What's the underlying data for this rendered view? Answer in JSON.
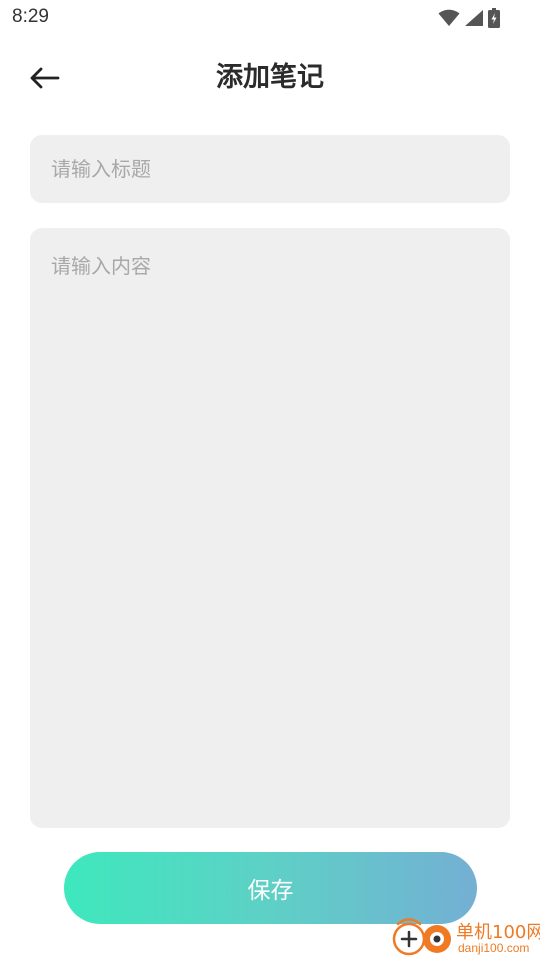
{
  "status_bar": {
    "time": "8:29",
    "icons": [
      "wifi-icon",
      "cellular-signal-icon",
      "battery-charging-icon"
    ]
  },
  "app_bar": {
    "back_icon": "arrow-left-icon",
    "title": "添加笔记"
  },
  "form": {
    "title_input": {
      "value": "",
      "placeholder": "请输入标题"
    },
    "content_input": {
      "value": "",
      "placeholder": "请输入内容"
    },
    "save_label": "保存"
  },
  "watermark": {
    "name": "单机100网",
    "url": "danji100.com"
  },
  "colors": {
    "background": "#ffffff",
    "input_background": "#efefef",
    "placeholder": "#a8a8a8",
    "title_text": "#2b2b2b",
    "button_gradient_start": "#3ee8bd",
    "button_gradient_end": "#74afd4",
    "button_text": "#ffffff",
    "watermark": "#f07a24"
  }
}
